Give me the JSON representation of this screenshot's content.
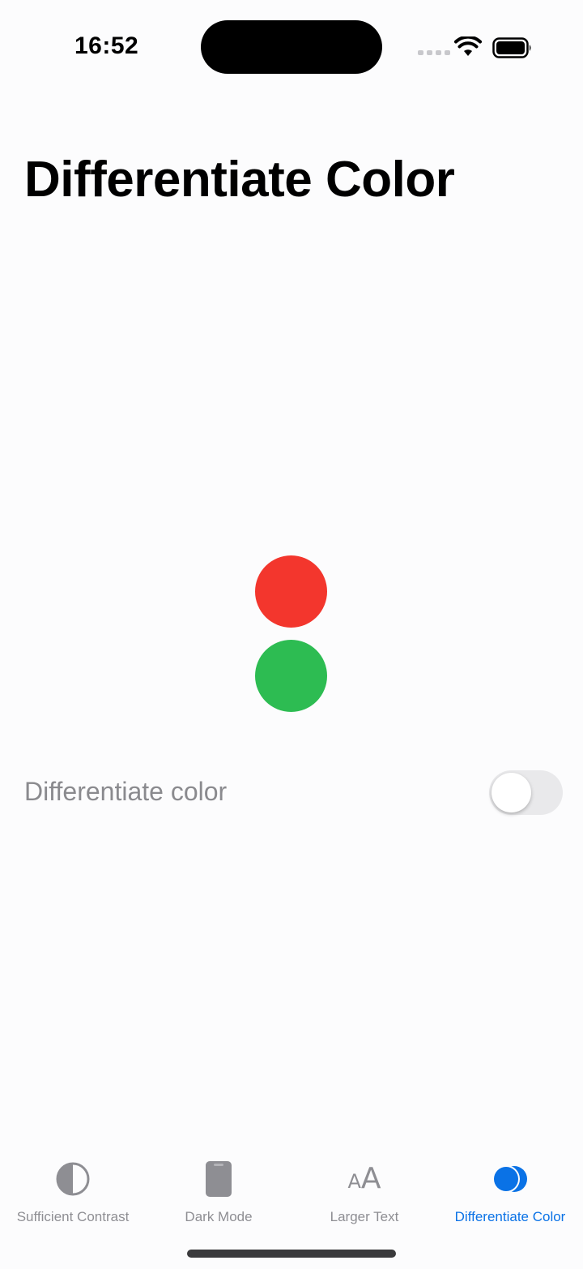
{
  "status_bar": {
    "time": "16:52"
  },
  "page": {
    "title": "Differentiate Color"
  },
  "indicators": {
    "top_color": "#f3362d",
    "bottom_color": "#2dbc52"
  },
  "toggle": {
    "label": "Differentiate color",
    "on": false
  },
  "tab_bar": {
    "active_color": "#0a72e6",
    "inactive_color": "#8e8e93",
    "tabs": [
      {
        "label": "Sufficient Contrast",
        "icon": "circle-half-icon"
      },
      {
        "label": "Dark Mode",
        "icon": "phone-icon"
      },
      {
        "label": "Larger Text",
        "icon": "text-size-icon",
        "glyph_small": "A",
        "glyph_big": "A"
      },
      {
        "label": "Differentiate Color",
        "icon": "overlapping-circles-icon"
      }
    ]
  }
}
